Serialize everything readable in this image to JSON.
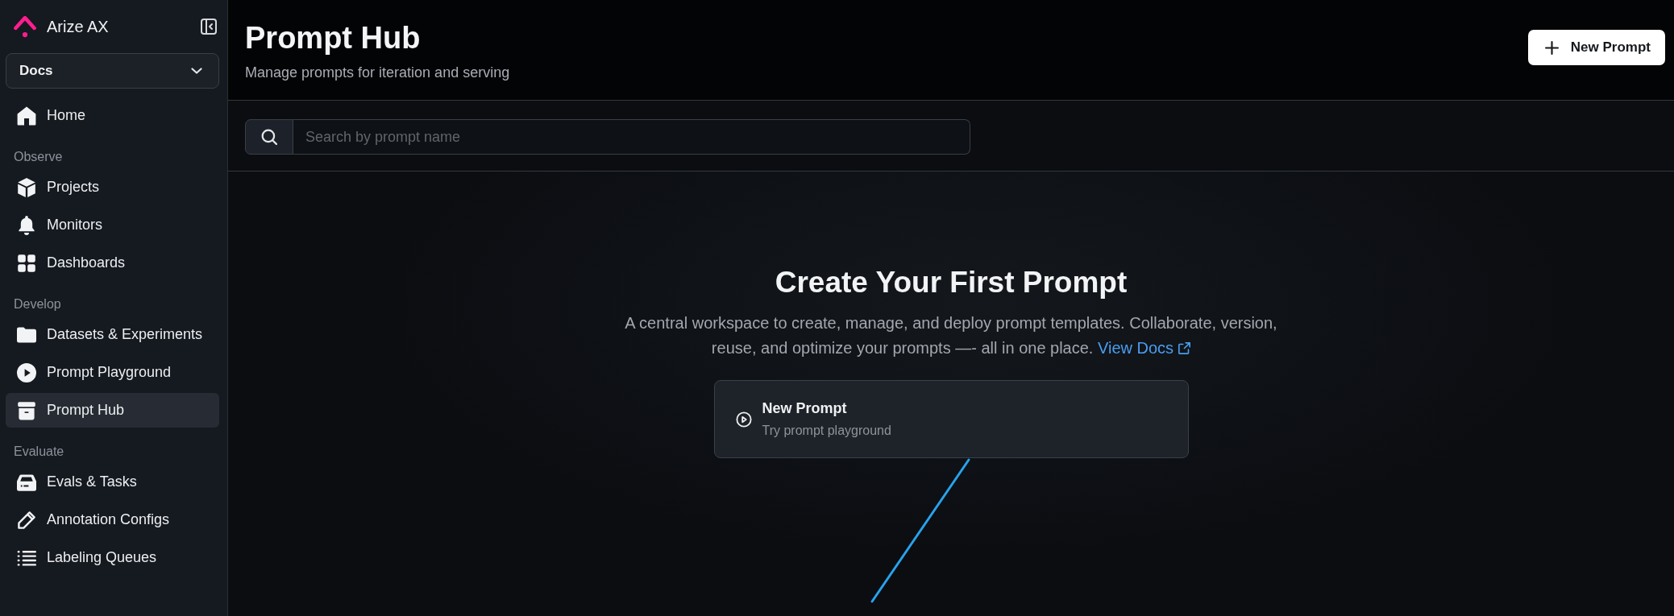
{
  "sidebar": {
    "brand": "Arize AX",
    "workspace_select": {
      "value": "Docs"
    },
    "sections": [
      {
        "items": [
          {
            "label": "Home",
            "selected": false
          }
        ]
      },
      {
        "heading": "Observe",
        "items": [
          {
            "label": "Projects",
            "selected": false
          },
          {
            "label": "Monitors",
            "selected": false
          },
          {
            "label": "Dashboards",
            "selected": false
          }
        ]
      },
      {
        "heading": "Develop",
        "items": [
          {
            "label": "Datasets & Experiments",
            "selected": false
          },
          {
            "label": "Prompt Playground",
            "selected": false
          },
          {
            "label": "Prompt Hub",
            "selected": true
          }
        ]
      },
      {
        "heading": "Evaluate",
        "items": [
          {
            "label": "Evals & Tasks",
            "selected": false
          },
          {
            "label": "Annotation Configs",
            "selected": false
          },
          {
            "label": "Labeling Queues",
            "selected": false
          }
        ]
      }
    ]
  },
  "header": {
    "title": "Prompt Hub",
    "subtitle": "Manage prompts for iteration and serving",
    "new_button": "New Prompt"
  },
  "search": {
    "placeholder": "Search by prompt name"
  },
  "empty_state": {
    "title": "Create Your First Prompt",
    "description": "A central workspace to create, manage, and deploy prompt templates. Collaborate, version, reuse, and optimize your prompts —- all in one place.",
    "link": "View Docs",
    "card": {
      "title": "New Prompt",
      "subtitle": "Try prompt playground"
    }
  }
}
